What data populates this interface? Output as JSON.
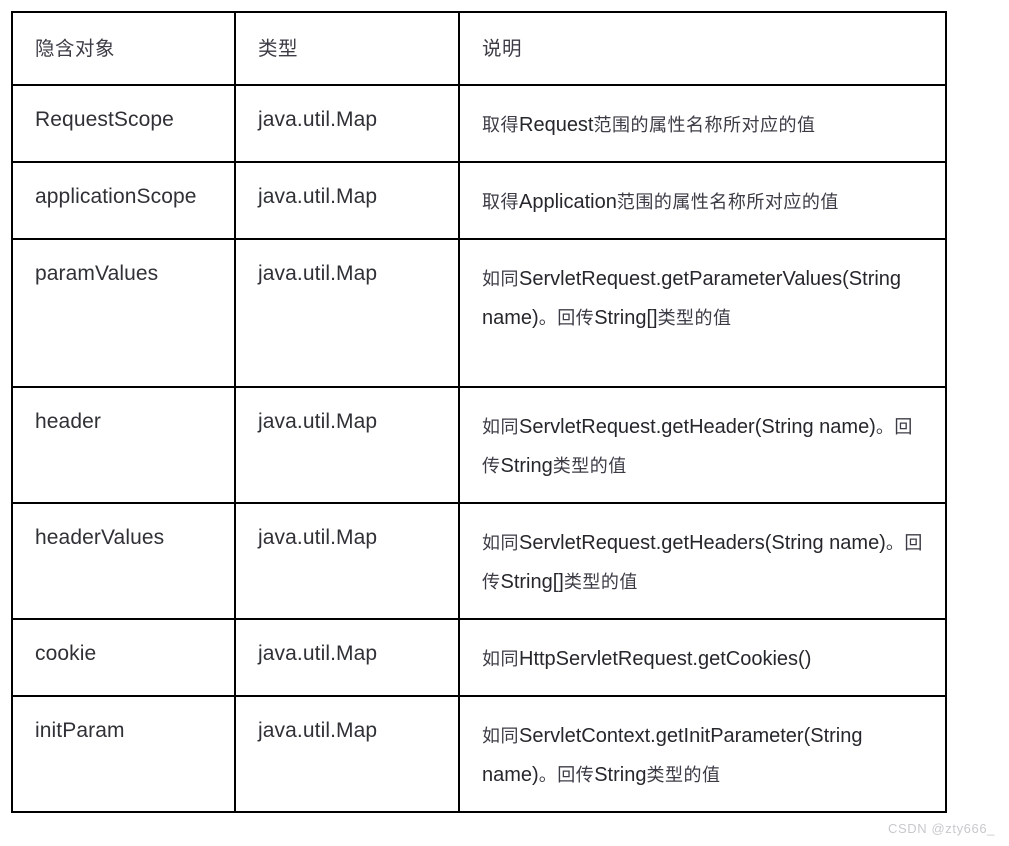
{
  "table": {
    "columns": [
      "隐含对象",
      "类型",
      "说明"
    ],
    "rows": [
      {
        "object": "RequestScope",
        "type": "java.util.Map",
        "description": "取得Request范围的属性名称所对应的值",
        "description_parts": [
          {
            "script": "cn",
            "text": "取得"
          },
          {
            "script": "en",
            "text": "Request"
          },
          {
            "script": "cn",
            "text": "范围的属性名称所对应的值"
          }
        ]
      },
      {
        "object": "applicationScope",
        "type": "java.util.Map",
        "description": "取得Application范围的属性名称所对应的值",
        "description_parts": [
          {
            "script": "cn",
            "text": "取得"
          },
          {
            "script": "en",
            "text": "Application"
          },
          {
            "script": "cn",
            "text": "范围的属性名称所对应的值"
          }
        ]
      },
      {
        "object": "paramValues",
        "type": "java.util.Map",
        "description": "如同ServletRequest.getParameterValues(String name)。回传String[]类型的值",
        "description_parts": [
          {
            "script": "cn",
            "text": "如同"
          },
          {
            "script": "en",
            "text": "ServletRequest.getParameterValues(String name)"
          },
          {
            "script": "cn",
            "text": "。回传"
          },
          {
            "script": "en",
            "text": "String[]"
          },
          {
            "script": "cn",
            "text": "类型的值"
          }
        ]
      },
      {
        "object": "header",
        "type": "java.util.Map",
        "description": "如同ServletRequest.getHeader(String name)。回传String类型的值",
        "description_parts": [
          {
            "script": "cn",
            "text": "如同"
          },
          {
            "script": "en",
            "text": "ServletRequest.getHeader(String name)"
          },
          {
            "script": "cn",
            "text": "。回传"
          },
          {
            "script": "en",
            "text": "String"
          },
          {
            "script": "cn",
            "text": "类型的值"
          }
        ]
      },
      {
        "object": "headerValues",
        "type": "java.util.Map",
        "description": "如同ServletRequest.getHeaders(String name)。回传String[]类型的值",
        "description_parts": [
          {
            "script": "cn",
            "text": "如同"
          },
          {
            "script": "en",
            "text": "ServletRequest.getHeaders(String name)"
          },
          {
            "script": "cn",
            "text": "。回传"
          },
          {
            "script": "en",
            "text": "String[]"
          },
          {
            "script": "cn",
            "text": "类型的值"
          }
        ]
      },
      {
        "object": "cookie",
        "type": "java.util.Map",
        "description": "如同HttpServletRequest.getCookies()",
        "description_parts": [
          {
            "script": "cn",
            "text": "如同"
          },
          {
            "script": "en",
            "text": "HttpServletRequest.getCookies()"
          }
        ]
      },
      {
        "object": "initParam",
        "type": "java.util.Map",
        "description": "如同ServletContext.getInitParameter(String name)。回传String类型的值",
        "description_parts": [
          {
            "script": "cn",
            "text": "如同"
          },
          {
            "script": "en",
            "text": "ServletContext.getInitParameter(String name)"
          },
          {
            "script": "cn",
            "text": "。回传"
          },
          {
            "script": "en",
            "text": "String"
          },
          {
            "script": "cn",
            "text": "类型的值"
          }
        ]
      }
    ]
  },
  "watermark": {
    "text": "CSDN @zty666_"
  },
  "colors": {
    "border": "#000000",
    "text": "#2f3136",
    "header_text": "#3c3c46",
    "watermark": "#c9c9cd",
    "background": "#ffffff"
  }
}
